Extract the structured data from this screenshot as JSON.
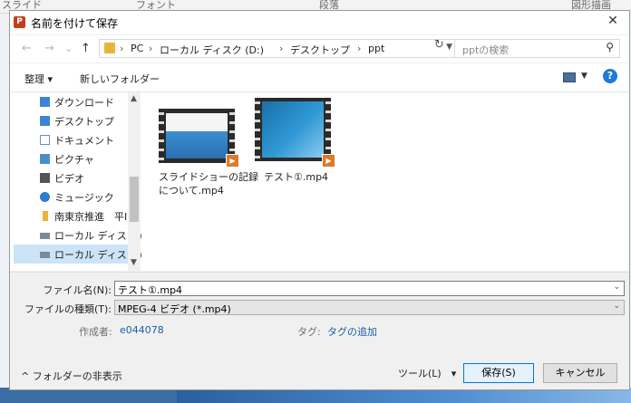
{
  "background": {
    "columns": [
      "スライド",
      "フォント",
      "段落",
      "図形描画"
    ]
  },
  "window": {
    "app_icon": "powerpoint-icon",
    "title": "名前を付けて保存",
    "close": "✕"
  },
  "nav": {
    "back": "←",
    "forward": "→",
    "recent": "⌄",
    "up": "↑",
    "breadcrumb": [
      "PC",
      "ローカル ディスク (D:)",
      "デスクトップ",
      "ppt"
    ],
    "separator": "›",
    "refresh": "↻",
    "search_placeholder": "pptの検索"
  },
  "toolbar": {
    "organize": "整理 ▾",
    "new_folder": "新しいフォルダー",
    "help": "?"
  },
  "sidebar": {
    "items": [
      {
        "label": "ダウンロード",
        "icon": "download-folder-icon",
        "color": "#3c84d6"
      },
      {
        "label": "デスクトップ",
        "icon": "desktop-folder-icon",
        "color": "#3c84d6"
      },
      {
        "label": "ドキュメント",
        "icon": "documents-icon",
        "color": "#6b8fb8"
      },
      {
        "label": "ピクチャ",
        "icon": "pictures-icon",
        "color": "#4a90c8"
      },
      {
        "label": "ビデオ",
        "icon": "videos-icon",
        "color": "#555555"
      },
      {
        "label": "ミュージック",
        "icon": "music-icon",
        "color": "#2f7bd0"
      },
      {
        "label": "南東京推進　平I",
        "icon": "folder-icon",
        "color": "#e6b53a"
      },
      {
        "label": "ローカル ディスク (C",
        "icon": "drive-c-icon",
        "color": "#7a8a99"
      },
      {
        "label": "ローカル ディスク (D",
        "icon": "drive-d-icon",
        "color": "#7a8a99"
      }
    ],
    "selected_index": 8
  },
  "files": [
    {
      "label_line1": "スライドショーの記録",
      "label_line2": "について.mp4",
      "icon": "video-file-icon"
    },
    {
      "label_line1": "テスト①.mp4",
      "label_line2": "",
      "icon": "video-file-icon"
    }
  ],
  "form": {
    "filename_label": "ファイル名(N):",
    "filename_value": "テスト①.mp4",
    "filetype_label": "ファイルの種類(T):",
    "filetype_value": "MPEG-4 ビデオ (*.mp4)",
    "author_label": "作成者:",
    "author_value": "e044078",
    "tags_label": "タグ:",
    "tags_value": "タグの追加"
  },
  "footer": {
    "hide_folders": "^ フォルダーの非表示",
    "tools": "ツール(L)　▾",
    "save": "保存(S)",
    "cancel": "キャンセル"
  },
  "colors": {
    "accent": "#0078d7",
    "selection": "#cce4f7",
    "link": "#1a5fa8"
  }
}
